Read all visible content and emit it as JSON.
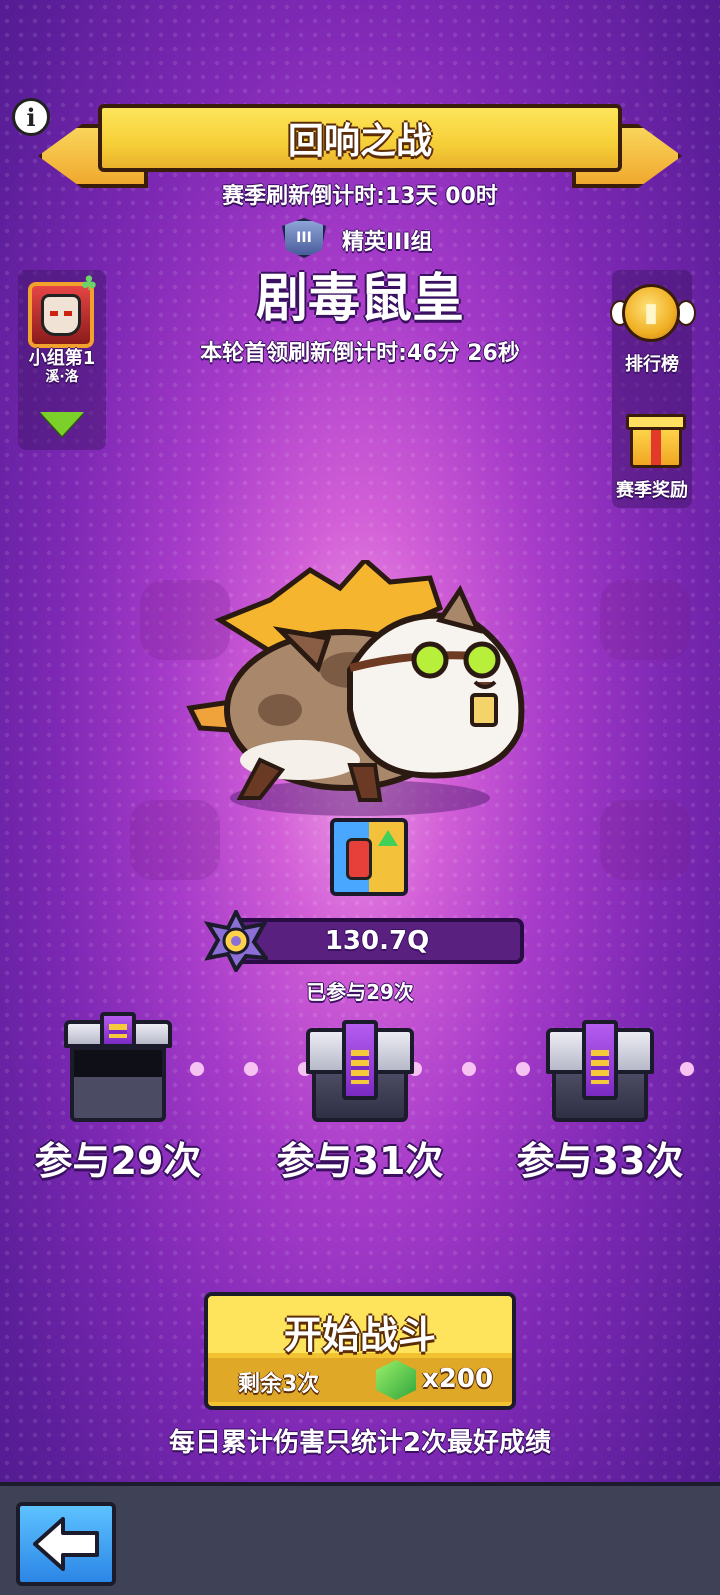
{
  "header": {
    "title": "回响之战",
    "season_countdown": "赛季刷新倒计时:13天 00时",
    "league_badge": "III",
    "league_group": "精英III组",
    "boss_name": "剧毒鼠皇",
    "boss_countdown": "本轮首领刷新倒计时:46分 26秒"
  },
  "player": {
    "rank_label": "小组第1",
    "name": "溪·洛"
  },
  "side_menu": {
    "leaderboard_label": "排行榜",
    "season_reward_label": "赛季奖励"
  },
  "boss": {
    "hp_text": "130.7Q",
    "participation_text": "已参与29次"
  },
  "chests": [
    {
      "label": "参与29次",
      "state": "opened"
    },
    {
      "label": "参与31次",
      "state": "locked"
    },
    {
      "label": "参与33次",
      "state": "locked"
    }
  ],
  "start": {
    "label": "开始战斗",
    "remaining": "剩余3次",
    "cost": "x200"
  },
  "note": "每日累计伤害只统计2次最好成绩",
  "icons": {
    "info": "info-icon",
    "leaderboard": "gold-medal-icon",
    "reward": "gift-box-icon",
    "back": "back-arrow-icon",
    "gem": "green-gem-icon"
  },
  "colors": {
    "accent_yellow": "#f6cf38",
    "bg_purple": "#7d28b4",
    "bottom_bar": "#3f4256"
  }
}
